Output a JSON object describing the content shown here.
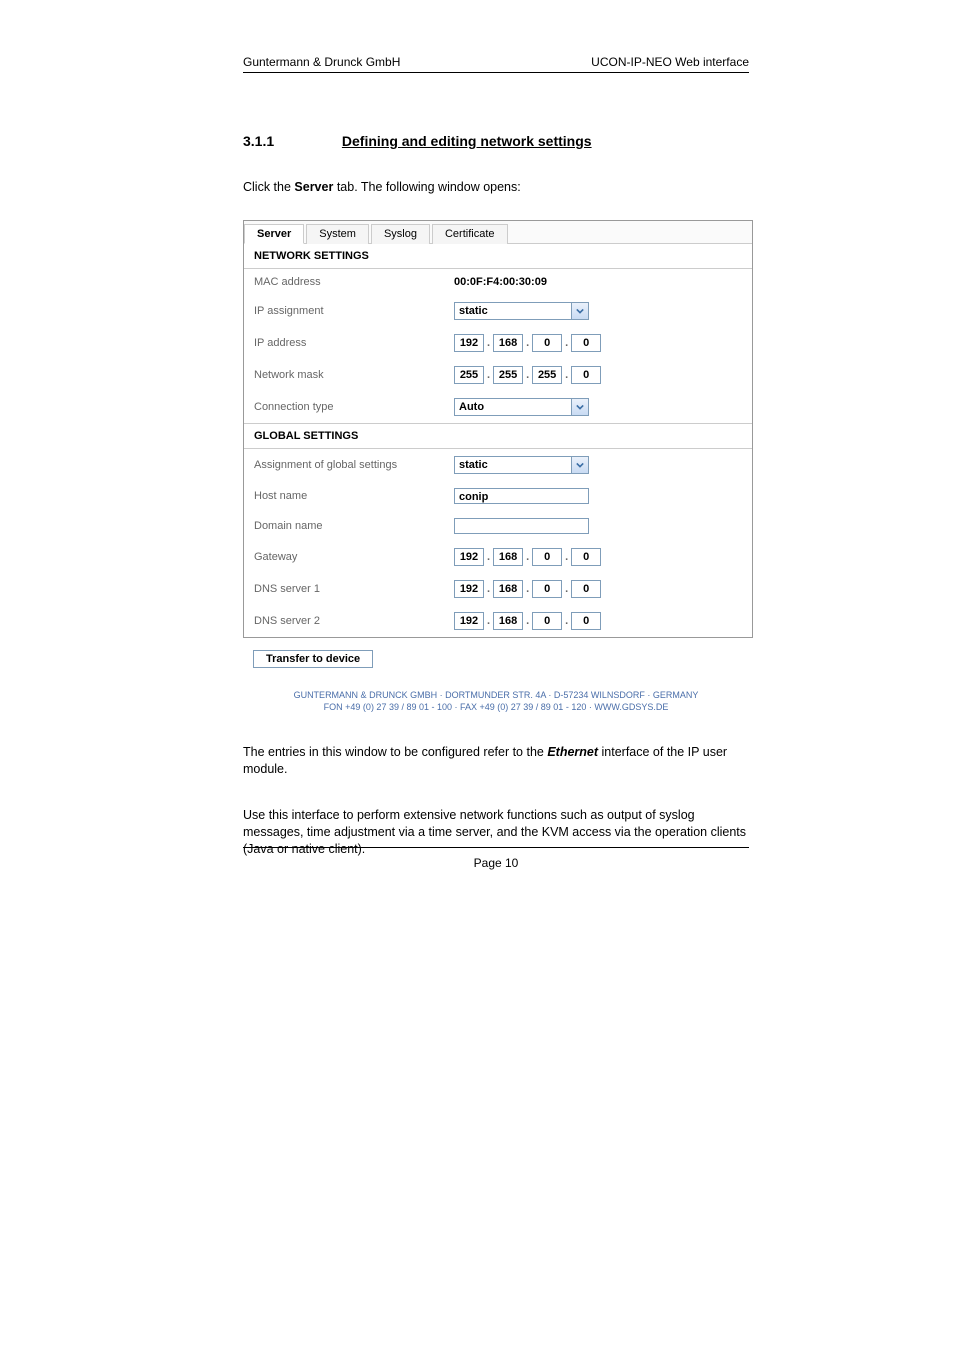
{
  "header": {
    "left": "Guntermann & Drunck GmbH",
    "right": "UCON-IP-NEO Web interface"
  },
  "section": {
    "number": "3.1.1",
    "title": "Defining and editing network settings"
  },
  "intro": {
    "prefix": "Click the ",
    "bold": "Server",
    "suffix": " tab. The following window opens:"
  },
  "tabs": [
    "Server",
    "System",
    "Syslog",
    "Certificate"
  ],
  "grp1": {
    "title": "NETWORK SETTINGS",
    "mac": {
      "label": "MAC address",
      "value": "00:0F:F4:00:30:09"
    },
    "ipassign": {
      "label": "IP assignment",
      "value": "static"
    },
    "ipaddr": {
      "label": "IP address",
      "o": [
        "192",
        "168",
        "0",
        "0"
      ]
    },
    "netmask": {
      "label": "Network mask",
      "o": [
        "255",
        "255",
        "255",
        "0"
      ]
    },
    "conn": {
      "label": "Connection type",
      "value": "Auto"
    }
  },
  "grp2": {
    "title": "GLOBAL SETTINGS",
    "gassign": {
      "label": "Assignment of global settings",
      "value": "static"
    },
    "host": {
      "label": "Host name",
      "value": "conip"
    },
    "domain": {
      "label": "Domain name",
      "value": ""
    },
    "gateway": {
      "label": "Gateway",
      "o": [
        "192",
        "168",
        "0",
        "0"
      ]
    },
    "dns1": {
      "label": "DNS server 1",
      "o": [
        "192",
        "168",
        "0",
        "0"
      ]
    },
    "dns2": {
      "label": "DNS server 2",
      "o": [
        "192",
        "168",
        "0",
        "0"
      ]
    }
  },
  "transfer": "Transfer to device",
  "cofooter": {
    "l1": "GUNTERMANN & DRUNCK GMBH · DORTMUNDER STR. 4A · D-57234 WILNSDORF · GERMANY",
    "l2a": "FON +49 (0) 27 39 / 89 01 - 100 · FAX +49 (0) 27 39 / 89 01 - 120 · ",
    "l2b": "WWW.GDSYS.DE"
  },
  "p1": {
    "a": "The entries in this window to be configured refer to the ",
    "b": "Ethernet",
    "c": " interface of the IP user module."
  },
  "p2": "Use this interface to perform extensive network functions such as output of syslog messages, time adjustment via a time server, and the KVM access via the operation clients (Java or native client).",
  "pagefoot": "Page 10"
}
